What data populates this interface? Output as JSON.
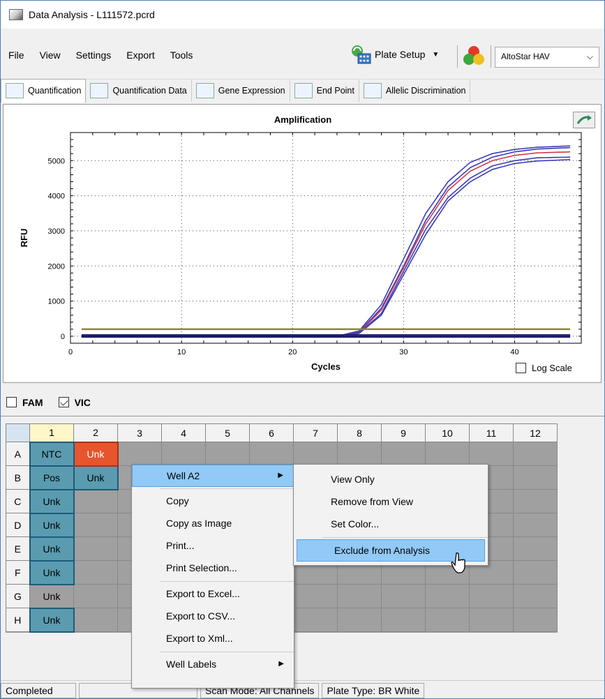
{
  "window": {
    "title": "Data Analysis - L111572.pcrd"
  },
  "menubar": {
    "items": [
      "File",
      "View",
      "Settings",
      "Export",
      "Tools"
    ],
    "plate_setup_label": "Plate Setup",
    "assay_combo": "AltoStar HAV"
  },
  "tabs": [
    "Quantification",
    "Quantification Data",
    "Gene Expression",
    "End Point",
    "Allelic Discrimination"
  ],
  "chart": {
    "log_scale_label": "Log Scale"
  },
  "chart_data": {
    "type": "line",
    "title": "Amplification",
    "xlabel": "Cycles",
    "ylabel": "RFU",
    "xlim": [
      0,
      46
    ],
    "ylim": [
      -200,
      5800
    ],
    "xticks": [
      0,
      10,
      20,
      30,
      40
    ],
    "yticks": [
      0,
      1000,
      2000,
      3000,
      4000,
      5000
    ],
    "grid": true,
    "log_scale": false,
    "series": [
      {
        "color": "#3b3bb8",
        "x": [
          1,
          24,
          26,
          28,
          30,
          32,
          34,
          36,
          38,
          40,
          42,
          45
        ],
        "y": [
          0,
          0,
          150,
          900,
          2200,
          3500,
          4400,
          4950,
          5200,
          5320,
          5380,
          5420
        ]
      },
      {
        "color": "#3b3bb8",
        "x": [
          1,
          24,
          26,
          28,
          30,
          32,
          34,
          36,
          38,
          40,
          42,
          45
        ],
        "y": [
          0,
          0,
          120,
          800,
          2000,
          3300,
          4250,
          4800,
          5100,
          5250,
          5330,
          5370
        ]
      },
      {
        "color": "#d03a4a",
        "x": [
          1,
          24,
          26,
          28,
          30,
          32,
          34,
          36,
          38,
          40,
          42,
          45
        ],
        "y": [
          0,
          0,
          100,
          750,
          1950,
          3200,
          4150,
          4700,
          5000,
          5150,
          5220,
          5250
        ]
      },
      {
        "color": "#3b3bb8",
        "x": [
          1,
          24,
          26,
          28,
          30,
          32,
          34,
          36,
          38,
          40,
          42,
          45
        ],
        "y": [
          0,
          0,
          90,
          650,
          1850,
          3050,
          3950,
          4500,
          4850,
          5000,
          5080,
          5100
        ]
      },
      {
        "color": "#3b3bb8",
        "x": [
          1,
          24,
          26,
          28,
          30,
          32,
          34,
          36,
          38,
          40,
          42,
          45
        ],
        "y": [
          0,
          0,
          80,
          600,
          1750,
          2900,
          3850,
          4400,
          4750,
          4920,
          4990,
          5030
        ]
      },
      {
        "color": "#8a8a20",
        "x": [
          1,
          45
        ],
        "y": [
          200,
          200
        ]
      },
      {
        "color": "#1a1a6a",
        "x": [
          1,
          45
        ],
        "y": [
          -20,
          -20
        ]
      },
      {
        "color": "#1a1a6a",
        "x": [
          1,
          45
        ],
        "y": [
          30,
          30
        ]
      }
    ]
  },
  "channels": [
    {
      "label": "FAM",
      "checked": false
    },
    {
      "label": "VIC",
      "checked": true
    }
  ],
  "plate": {
    "columns": [
      "1",
      "2",
      "3",
      "4",
      "5",
      "6",
      "7",
      "8",
      "9",
      "10",
      "11",
      "12"
    ],
    "rows": [
      {
        "label": "A",
        "wells": [
          {
            "text": "NTC",
            "style": "blue"
          },
          {
            "text": "Unk",
            "style": "orange"
          }
        ]
      },
      {
        "label": "B",
        "wells": [
          {
            "text": "Pos",
            "style": "blue"
          },
          {
            "text": "Unk",
            "style": "blue"
          }
        ]
      },
      {
        "label": "C",
        "wells": [
          {
            "text": "Unk",
            "style": "blue"
          }
        ]
      },
      {
        "label": "D",
        "wells": [
          {
            "text": "Unk",
            "style": "blue"
          }
        ]
      },
      {
        "label": "E",
        "wells": [
          {
            "text": "Unk",
            "style": "blue"
          }
        ]
      },
      {
        "label": "F",
        "wells": [
          {
            "text": "Unk",
            "style": "blue"
          }
        ]
      },
      {
        "label": "G",
        "wells": [
          {
            "text": "Unk",
            "style": "grey"
          }
        ]
      },
      {
        "label": "H",
        "wells": [
          {
            "text": "Unk",
            "style": "blue"
          }
        ]
      }
    ]
  },
  "context_menu": {
    "items": [
      "Well A2",
      "Copy",
      "Copy as Image",
      "Print...",
      "Print Selection...",
      "Export to Excel...",
      "Export to CSV...",
      "Export to Xml...",
      "Well Labels"
    ]
  },
  "submenu": {
    "items": [
      "View Only",
      "Remove from View",
      "Set Color...",
      "Exclude from Analysis"
    ]
  },
  "statusbar": {
    "status": "Completed",
    "scan_mode": "Scan Mode: All Channels",
    "plate_type": "Plate Type: BR White"
  }
}
